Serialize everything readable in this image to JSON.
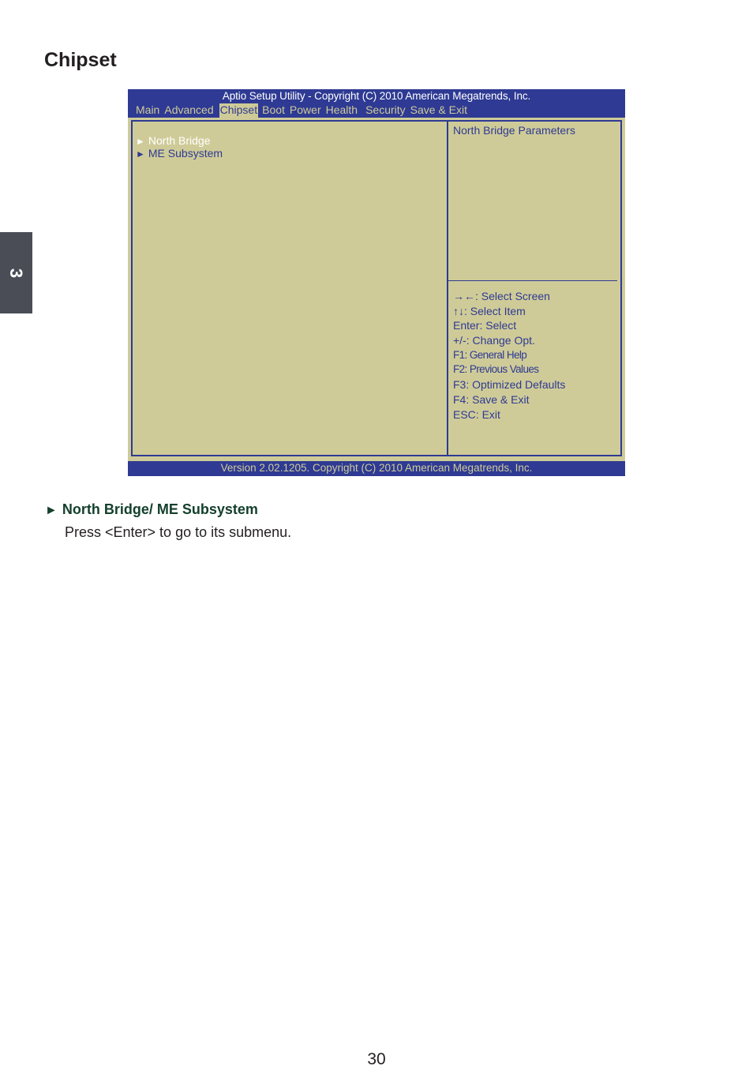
{
  "page": {
    "title": "Chipset",
    "chapter_number": "3",
    "page_number": "30"
  },
  "bios": {
    "title": "Aptio Setup Utility - Copyright (C) 2010 American Megatrends, Inc.",
    "menu": [
      {
        "label": "Main",
        "active": false
      },
      {
        "label": "Advanced",
        "active": false
      },
      {
        "label": "Chipset",
        "active": true
      },
      {
        "label": "Boot",
        "active": false
      },
      {
        "label": "Power",
        "active": false
      },
      {
        "label": "Health",
        "active": false
      },
      {
        "label": "Security",
        "active": false
      },
      {
        "label": "Save & Exit",
        "active": false
      }
    ],
    "items": [
      {
        "arrow": "►",
        "label": "North Bridge",
        "selected": true
      },
      {
        "arrow": "►",
        "label": "ME Subsystem",
        "selected": false
      }
    ],
    "help_text": "North Bridge Parameters",
    "keys": [
      "→←: Select Screen",
      "↑↓: Select Item",
      "Enter: Select",
      "+/-: Change Opt.",
      "F1:  General Help",
      "F2:  Previous Values",
      "F3: Optimized Defaults",
      "F4: Save & Exit",
      "ESC: Exit"
    ],
    "footer": "Version 2.02.1205. Copyright (C) 2010 American Megatrends, Inc.",
    "colors": {
      "header_bg": "#2e3a93",
      "panel_bg": "#cfcb98",
      "text": "#2e3a93",
      "selected_text": "#ffffff"
    }
  },
  "section": {
    "bullet": "►",
    "heading": "North Bridge/ ME Subsystem",
    "body": "Press <Enter> to go to its submenu."
  }
}
